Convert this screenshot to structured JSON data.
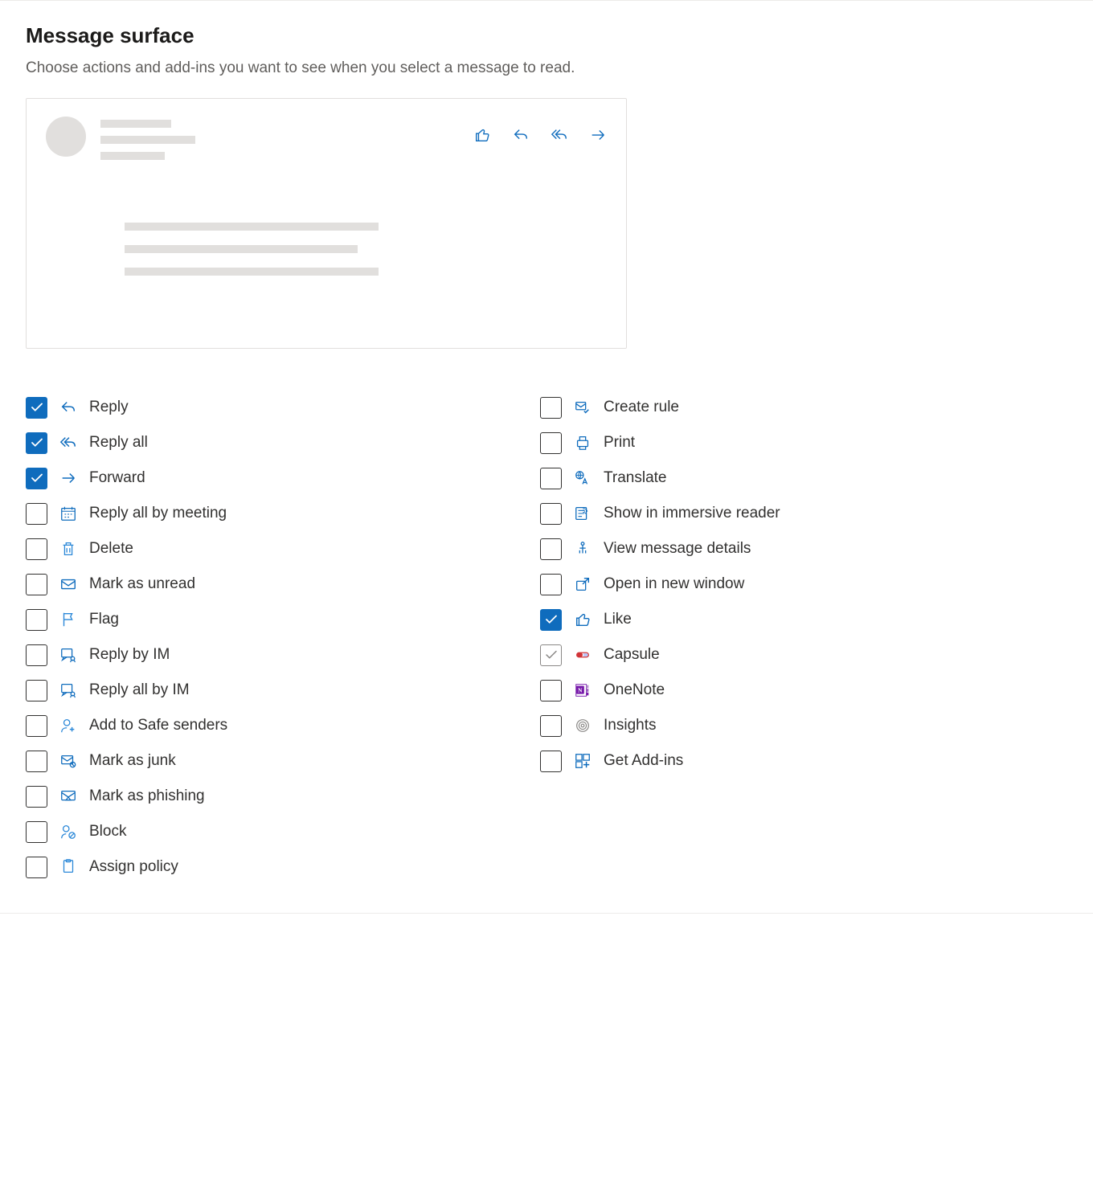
{
  "header": {
    "title": "Message surface",
    "subtitle": "Choose actions and add-ins you want to see when you select a message to read."
  },
  "preview_actions": [
    "like",
    "reply",
    "reply-all",
    "forward"
  ],
  "left": [
    {
      "label": "Reply",
      "icon": "reply",
      "checked": true
    },
    {
      "label": "Reply all",
      "icon": "reply-all",
      "checked": true
    },
    {
      "label": "Forward",
      "icon": "forward",
      "checked": true
    },
    {
      "label": "Reply all by meeting",
      "icon": "calendar",
      "checked": false
    },
    {
      "label": "Delete",
      "icon": "trash",
      "checked": false
    },
    {
      "label": "Mark as unread",
      "icon": "mail",
      "checked": false
    },
    {
      "label": "Flag",
      "icon": "flag",
      "checked": false
    },
    {
      "label": "Reply by IM",
      "icon": "im",
      "checked": false
    },
    {
      "label": "Reply all by IM",
      "icon": "im",
      "checked": false
    },
    {
      "label": "Add to Safe senders",
      "icon": "person-add",
      "checked": false
    },
    {
      "label": "Mark as junk",
      "icon": "junk",
      "checked": false
    },
    {
      "label": "Mark as phishing",
      "icon": "phishing",
      "checked": false
    },
    {
      "label": "Block",
      "icon": "block",
      "checked": false
    },
    {
      "label": "Assign policy",
      "icon": "policy",
      "checked": false
    }
  ],
  "right": [
    {
      "label": "Create rule",
      "icon": "rule",
      "checked": false
    },
    {
      "label": "Print",
      "icon": "print",
      "checked": false
    },
    {
      "label": "Translate",
      "icon": "translate",
      "checked": false
    },
    {
      "label": "Show in immersive reader",
      "icon": "immersive",
      "checked": false
    },
    {
      "label": "View message details",
      "icon": "details",
      "checked": false
    },
    {
      "label": "Open in new window",
      "icon": "popout",
      "checked": false
    },
    {
      "label": "Like",
      "icon": "like",
      "checked": true
    },
    {
      "label": "Capsule",
      "icon": "capsule",
      "checked": false,
      "disabled": true
    },
    {
      "label": "OneNote",
      "icon": "onenote",
      "checked": false
    },
    {
      "label": "Insights",
      "icon": "insights",
      "checked": false
    },
    {
      "label": "Get Add-ins",
      "icon": "addins",
      "checked": false
    }
  ]
}
